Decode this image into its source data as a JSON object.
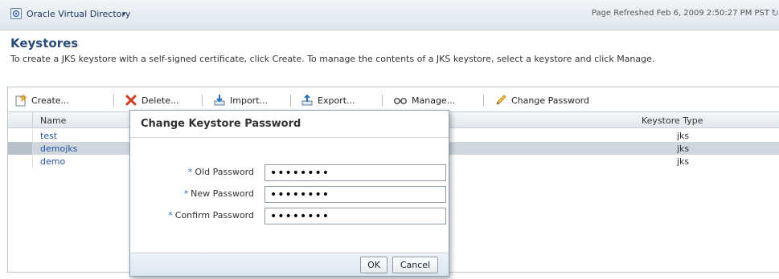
{
  "header": {
    "app_title": "Oracle Virtual Directory",
    "caret": "▾",
    "refreshed": "Page Refreshed Feb 6, 2009 2:50:27 PM PST"
  },
  "page": {
    "title": "Keystores",
    "description": "To create a JKS keystore with a self-signed certificate, click Create. To manage the contents of a JKS keystore, select a keystore and click Manage."
  },
  "toolbar": {
    "create": "Create...",
    "delete": "Delete...",
    "import": "Import...",
    "export": "Export...",
    "manage": "Manage...",
    "change_password": "Change Password"
  },
  "table": {
    "columns": [
      "Name",
      "Keystore Type"
    ],
    "rows": [
      {
        "name": "test",
        "type": "jks"
      },
      {
        "name": "demojks",
        "type": "jks"
      },
      {
        "name": "demo",
        "type": "jks"
      }
    ],
    "selected_index": 1
  },
  "dialog": {
    "title": "Change Keystore Password",
    "required_marker": "*",
    "fields": [
      {
        "label": "Old Password",
        "value": "••••••••"
      },
      {
        "label": "New Password",
        "value": "••••••••"
      },
      {
        "label": "Confirm Password",
        "value": "••••••••"
      }
    ],
    "ok_label": "OK",
    "cancel_label": "Cancel"
  },
  "colors": {
    "link": "#2756a0",
    "title": "#2b4c78",
    "selected_row": "#cfd6dd"
  }
}
